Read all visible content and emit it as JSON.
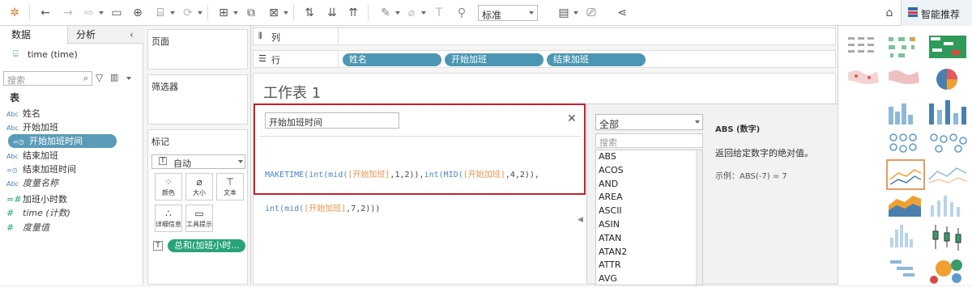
{
  "toolbar": {
    "combo_value": "标准",
    "smart_recommend": "智能推荐"
  },
  "left_panel": {
    "tab_data": "数据",
    "tab_analysis": "分析",
    "datasource": "time (time)",
    "search_placeholder": "搜索",
    "table_heading": "表",
    "fields": [
      {
        "type": "Abc",
        "name": "姓名",
        "italic": false
      },
      {
        "type": "Abc",
        "name": "开始加班",
        "italic": false
      },
      {
        "type": "calc-date",
        "name": "开始加班时间",
        "italic": false,
        "selected": true
      },
      {
        "type": "Abc",
        "name": "结束加班",
        "italic": false
      },
      {
        "type": "calc-date",
        "name": "结束加班时间",
        "italic": false
      },
      {
        "type": "Abc",
        "name": "度量名称",
        "italic": true
      },
      {
        "type": "calc-num",
        "name": "加班小时数",
        "italic": false
      },
      {
        "type": "#",
        "name": "time (计数)",
        "italic": true
      },
      {
        "type": "#",
        "name": "度量值",
        "italic": true
      }
    ]
  },
  "shelves": {
    "pages": "页面",
    "filters": "筛选器",
    "marks": "标记",
    "mark_type": "自动",
    "mark_buttons": [
      "颜色",
      "大小",
      "文本",
      "详细信息",
      "工具提示"
    ],
    "mark_pill": "总和(加班小时..."
  },
  "columns_label": "列",
  "rows_label": "行",
  "row_pills": [
    "姓名",
    "开始加班",
    "结束加班"
  ],
  "sheet_title": "工作表 1",
  "calc": {
    "name": "开始加班时间",
    "formula_line1": [
      [
        "fn",
        "MAKETIME("
      ],
      [
        "fn",
        "int("
      ],
      [
        "fn",
        "mid("
      ],
      [
        "fld",
        "[开始加班]"
      ],
      [
        "pn",
        ",1,2)"
      ],
      [
        "pn",
        "),"
      ],
      [
        "fn",
        "int("
      ],
      [
        "fn",
        "MID("
      ],
      [
        "fld",
        "[开始加班]"
      ],
      [
        "pn",
        ",4,2)),"
      ]
    ],
    "formula_line2": [
      [
        "fn",
        "int("
      ],
      [
        "fn",
        "mid("
      ],
      [
        "fld",
        "[开始加班]"
      ],
      [
        "pn",
        ",7,2))"
      ],
      [
        "pn",
        ")"
      ]
    ]
  },
  "functions": {
    "category": "全部",
    "search_placeholder": "搜索",
    "list": [
      "ABS",
      "ACOS",
      "AND",
      "AREA",
      "ASCII",
      "ASIN",
      "ATAN",
      "ATAN2",
      "ATTR",
      "AVG"
    ],
    "detail_title": "ABS (数字)",
    "detail_desc": "返回给定数字的绝对值。",
    "detail_example": "示例：ABS(-7) = 7"
  }
}
